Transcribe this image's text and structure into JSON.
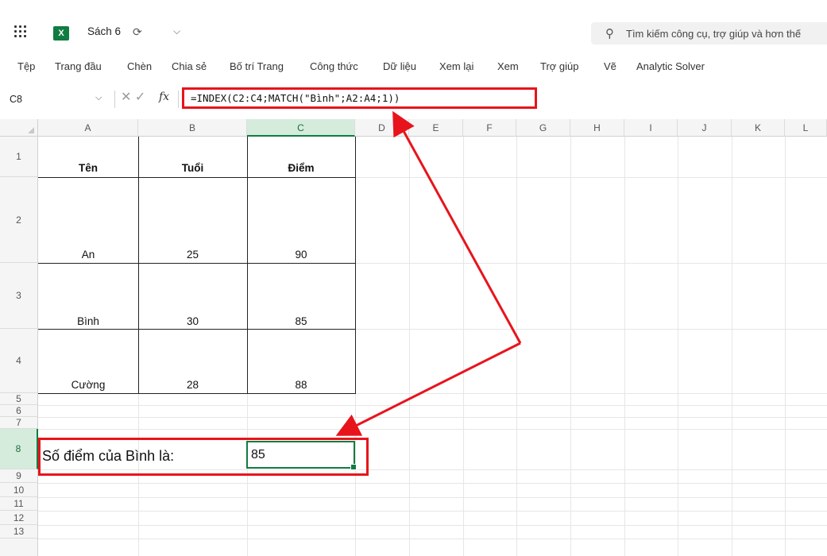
{
  "app": {
    "file_title": "Sách 6",
    "search_placeholder": "Tìm kiếm công cụ, trợ giúp và hơn thế",
    "excel_logo": "X"
  },
  "ribbon": {
    "tabs": [
      "Tệp",
      "Trang đầu",
      "Chèn",
      "Chia sẻ",
      "Bố trí Trang",
      "Công thức",
      "Dữ liệu",
      "Xem lại",
      "Xem",
      "Trợ giúp",
      "Vẽ",
      "Analytic Solver"
    ]
  },
  "formula_bar": {
    "name_box": "C8",
    "fx_label": "fx",
    "formula": "=INDEX(C2:C4;MATCH(\"Bình\";A2:A4;1))"
  },
  "columns": [
    "A",
    "B",
    "C",
    "D",
    "E",
    "F",
    "G",
    "H",
    "I",
    "J",
    "K",
    "L"
  ],
  "rows": [
    "1",
    "2",
    "3",
    "4",
    "5",
    "6",
    "7",
    "8",
    "9",
    "10",
    "11",
    "12",
    "13"
  ],
  "table": {
    "headers": [
      "Tên",
      "Tuổi",
      "Điểm"
    ],
    "rows": [
      [
        "An",
        "25",
        "90"
      ],
      [
        "Bình",
        "30",
        "85"
      ],
      [
        "Cường",
        "28",
        "88"
      ]
    ]
  },
  "result": {
    "label": "Số điểm của Bình là:",
    "value": "85"
  },
  "colors": {
    "accent": "#107c41",
    "annotation": "#e8141c"
  },
  "icons": [
    "app-launcher-icon",
    "excel-icon",
    "sync-icon",
    "chevron-down-icon",
    "search-icon",
    "cancel-icon",
    "enter-icon",
    "function-icon"
  ]
}
